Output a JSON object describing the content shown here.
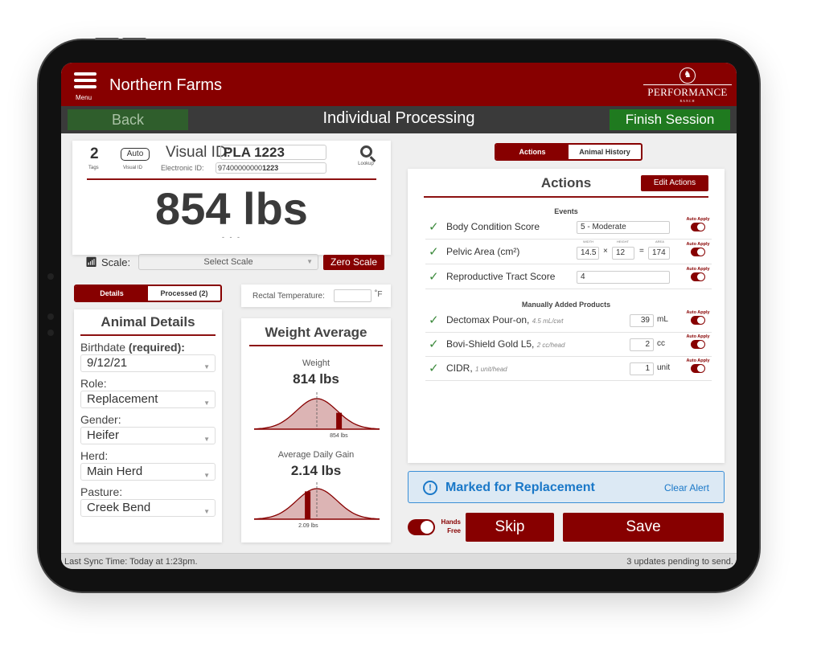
{
  "header": {
    "menu_label": "Menu",
    "farm_name": "Northern Farms",
    "logo_text": "PERFORMANCE",
    "logo_subtext": "RANCH"
  },
  "nav": {
    "back_label": "Back",
    "title": "Individual Processing",
    "finish_label": "Finish Session"
  },
  "identity": {
    "tags_count": "2",
    "tags_label": "Tags",
    "auto_label": "Auto",
    "auto_sublabel": "Visual ID",
    "visual_id_label": "Visual ID:",
    "visual_id_value": "PLA 1223",
    "electronic_id_label": "Electronic ID:",
    "electronic_id_prefix": "97400000000",
    "electronic_id_suffix": "1223",
    "lookup_label": "Lookup",
    "weight": "854 lbs",
    "weight_sub": "- - -",
    "scale_label": "Scale:",
    "scale_placeholder": "Select Scale",
    "zero_scale_label": "Zero Scale"
  },
  "left_tabs": {
    "details": "Details",
    "processed": "Processed (2)",
    "active": "details"
  },
  "rectal_temperature": {
    "label": "Rectal Temperature:",
    "value": "",
    "unit": "˚F"
  },
  "animal_details": {
    "title": "Animal Details",
    "fields": [
      {
        "label": "Birthdate",
        "label_bold": " (required):",
        "value": "9/12/21"
      },
      {
        "label": "Role:",
        "label_bold": "",
        "value": "Replacement"
      },
      {
        "label": "Gender:",
        "label_bold": "",
        "value": "Heifer"
      },
      {
        "label": "Herd:",
        "label_bold": "",
        "value": "Main Herd"
      },
      {
        "label": "Pasture:",
        "label_bold": "",
        "value": "Creek Bend"
      }
    ]
  },
  "weight_average": {
    "title": "Weight Average",
    "weight": {
      "label": "Weight",
      "average": "814 lbs",
      "animal": "854 lbs",
      "animal_position": 0.68
    },
    "adg": {
      "label": "Average Daily Gain",
      "average": "2.14 lbs",
      "animal": "2.09 lbs",
      "animal_position": 0.43
    }
  },
  "right_tabs": {
    "actions": "Actions",
    "history": "Animal History",
    "active": "actions"
  },
  "actions": {
    "title": "Actions",
    "edit_label": "Edit Actions",
    "auto_apply_label": "Auto Apply",
    "events_title": "Events",
    "events": [
      {
        "name": "Body Condition Score",
        "value": "5 - Moderate",
        "auto_apply": true
      },
      {
        "name": "Pelvic Area (cm²)",
        "width_label": "WIDTH",
        "height_label": "HEIGHT",
        "area_label": "AREA",
        "width": "14.5",
        "height": "12",
        "area": "174",
        "auto_apply": true
      },
      {
        "name": "Reproductive Tract Score",
        "value": "4",
        "auto_apply": true
      }
    ],
    "products_title": "Manually Added Products",
    "products": [
      {
        "name": "Dectomax Pour-on,",
        "dose": "4.5 mL/cwt",
        "amount": "39",
        "unit": "mL",
        "auto_apply": true
      },
      {
        "name": "Bovi-Shield Gold L5,",
        "dose": "2 cc/head",
        "amount": "2",
        "unit": "cc",
        "auto_apply": true
      },
      {
        "name": "CIDR,",
        "dose": "1 unit/head",
        "amount": "1",
        "unit": "unit",
        "auto_apply": true
      }
    ]
  },
  "alert": {
    "icon": "!",
    "text": "Marked for Replacement",
    "clear_label": "Clear Alert"
  },
  "footer": {
    "hands_free_line1": "Hands",
    "hands_free_line2": "Free",
    "hands_free_on": true,
    "skip_label": "Skip",
    "save_label": "Save"
  },
  "status": {
    "last_sync": "Last Sync Time: Today at 1:23pm.",
    "pending": "3 updates pending to send."
  },
  "colors": {
    "brand": "#870000",
    "nav_bg": "#3a3a3a",
    "back_green": "#2f5e2c",
    "finish_green": "#1f7a1f",
    "alert_blue": "#1a78c8",
    "check_green": "#3c8a3c"
  }
}
